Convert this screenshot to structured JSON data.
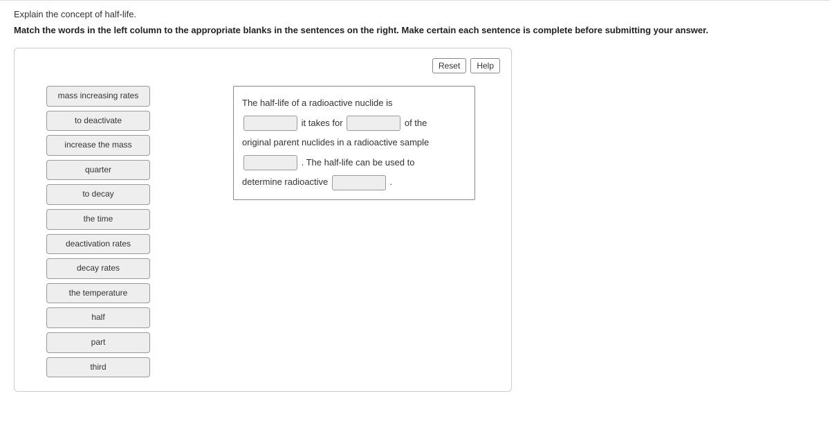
{
  "intro": "Explain the concept of half-life.",
  "instruction": "Match the words in the left column to the appropriate blanks in the sentences on the right. Make certain each sentence is complete before submitting your answer.",
  "toolbar": {
    "reset": "Reset",
    "help": "Help"
  },
  "word_bank": [
    "mass increasing rates",
    "to deactivate",
    "increase the mass",
    "quarter",
    "to decay",
    "the time",
    "deactivation rates",
    "decay rates",
    "the temperature",
    "half",
    "part",
    "third"
  ],
  "sentence": {
    "part1": "The half-life of a radioactive nuclide is",
    "part2": "it takes for",
    "part3": "of the",
    "part4": "original parent nuclides in a radioactive sample",
    "part5": ". The half-life can be used to",
    "part6": "determine radioactive",
    "part7": "."
  }
}
